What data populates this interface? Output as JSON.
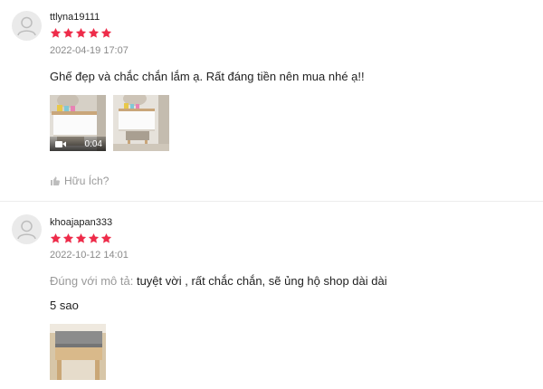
{
  "reviews": [
    {
      "username": "ttlyna19111",
      "rating": 5,
      "datetime": "2022-04-19 17:07",
      "comment": "Ghế đẹp và chắc chắn lắm ạ. Rất đáng tiền nên mua nhé ạ!!",
      "video_duration": "0:04",
      "helpful_label": "Hữu Ích?"
    },
    {
      "username": "khoajapan333",
      "rating": 5,
      "datetime": "2022-10-12 14:01",
      "attribute_label": "Đúng với mô tả:",
      "attribute_value": "tuyệt vời , rất chắc chắn, sẽ ủng hộ shop dài dài",
      "comment": "5 sao"
    }
  ],
  "colors": {
    "star": "#ee2c4a",
    "muted_text": "#8a8a8a",
    "divider": "#ececec"
  },
  "icons": [
    "avatar-placeholder-icon",
    "star-icon",
    "video-camera-icon",
    "thumbs-up-icon"
  ]
}
